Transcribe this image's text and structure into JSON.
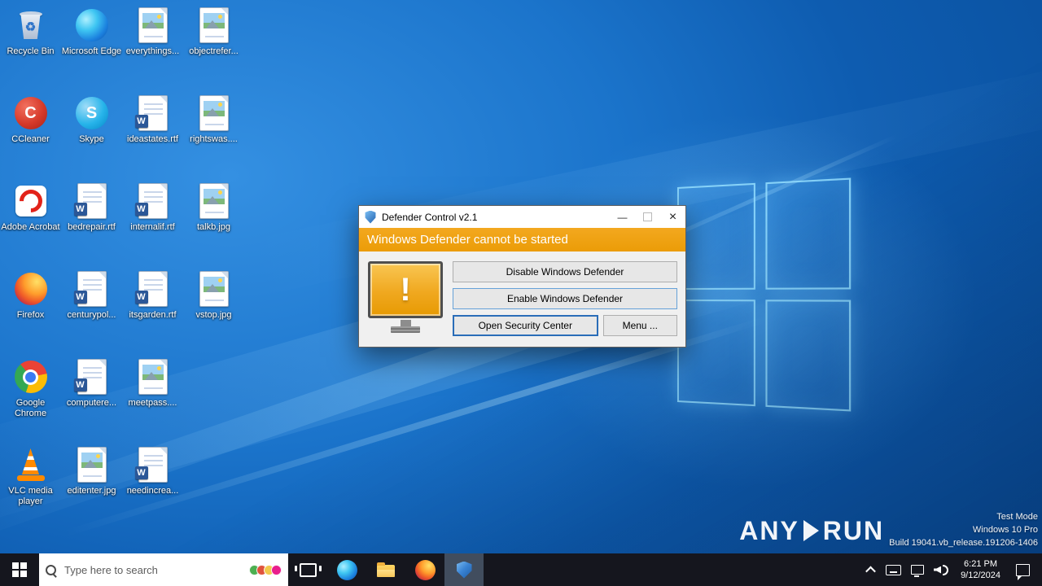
{
  "wallpaper": {
    "base_color": "#0e5cb0",
    "accent_glow": "#7ec8ff"
  },
  "desktop": {
    "icons": [
      {
        "name": "recycle-bin",
        "type": "recycle",
        "label": "Recycle Bin",
        "col": 0,
        "row": 0
      },
      {
        "name": "microsoft-edge",
        "type": "edge",
        "label": "Microsoft Edge",
        "col": 1,
        "row": 0
      },
      {
        "name": "file-everythings",
        "type": "image",
        "label": "everythings...",
        "col": 2,
        "row": 0
      },
      {
        "name": "file-objectrefer",
        "type": "image",
        "label": "objectrefer...",
        "col": 3,
        "row": 0
      },
      {
        "name": "ccleaner",
        "type": "ccleaner",
        "label": "CCleaner",
        "col": 0,
        "row": 1
      },
      {
        "name": "skype",
        "type": "skype",
        "label": "Skype",
        "col": 1,
        "row": 1
      },
      {
        "name": "file-ideastates",
        "type": "word",
        "label": "ideastates.rtf",
        "col": 2,
        "row": 1
      },
      {
        "name": "file-rightswas",
        "type": "image",
        "label": "rightswas....",
        "col": 3,
        "row": 1
      },
      {
        "name": "adobe-acrobat",
        "type": "acrobat",
        "label": "Adobe Acrobat",
        "col": 0,
        "row": 2
      },
      {
        "name": "file-bedrepair",
        "type": "word",
        "label": "bedrepair.rtf",
        "col": 1,
        "row": 2
      },
      {
        "name": "file-internalif",
        "type": "word",
        "label": "internalif.rtf",
        "col": 2,
        "row": 2
      },
      {
        "name": "file-talkb",
        "type": "image",
        "label": "talkb.jpg",
        "col": 3,
        "row": 2
      },
      {
        "name": "firefox",
        "type": "firefox",
        "label": "Firefox",
        "col": 0,
        "row": 3
      },
      {
        "name": "file-centurypol",
        "type": "word",
        "label": "centurypol...",
        "col": 1,
        "row": 3
      },
      {
        "name": "file-itsgarden",
        "type": "word",
        "label": "itsgarden.rtf",
        "col": 2,
        "row": 3
      },
      {
        "name": "file-vstop",
        "type": "image",
        "label": "vstop.jpg",
        "col": 3,
        "row": 3
      },
      {
        "name": "google-chrome",
        "type": "chrome",
        "label": "Google Chrome",
        "col": 0,
        "row": 4
      },
      {
        "name": "file-computere",
        "type": "word",
        "label": "computere...",
        "col": 1,
        "row": 4
      },
      {
        "name": "file-meetpass",
        "type": "image",
        "label": "meetpass....",
        "col": 2,
        "row": 4
      },
      {
        "name": "vlc-media-player",
        "type": "vlc",
        "label": "VLC media player",
        "col": 0,
        "row": 5
      },
      {
        "name": "file-editenter",
        "type": "image",
        "label": "editenter.jpg",
        "col": 1,
        "row": 5
      },
      {
        "name": "file-needincrea",
        "type": "word",
        "label": "needincrea...",
        "col": 2,
        "row": 5
      }
    ]
  },
  "dialog": {
    "title": "Defender Control v2.1",
    "banner": "Windows Defender cannot be started",
    "warning_glyph": "!",
    "controls": {
      "minimize": "—",
      "close": "×"
    },
    "buttons": {
      "disable": "Disable Windows Defender",
      "enable": "Enable Windows Defender",
      "open_security": "Open Security Center",
      "menu": "Menu ..."
    }
  },
  "taskbar": {
    "search": {
      "placeholder": "Type here to search"
    },
    "apps": [
      {
        "name": "task-view",
        "type": "taskview",
        "active": false
      },
      {
        "name": "microsoft-edge",
        "type": "edge",
        "active": false
      },
      {
        "name": "file-explorer",
        "type": "explorer",
        "active": false
      },
      {
        "name": "firefox",
        "type": "firefox",
        "active": false
      },
      {
        "name": "defender-control",
        "type": "defender",
        "active": true
      }
    ],
    "tray": {
      "icons": [
        {
          "name": "chevron-up"
        },
        {
          "name": "touch-keyboard"
        },
        {
          "name": "network"
        },
        {
          "name": "volume"
        }
      ],
      "clock": {
        "time": "6:21 PM",
        "date": "9/12/2024"
      }
    }
  },
  "watermark": {
    "brand_left": "ANY",
    "brand_right": "RUN",
    "lines": [
      "Test Mode",
      "Windows 10 Pro",
      "Build 19041.vb_release.191206-1406"
    ]
  },
  "icon_glyphs": {
    "recycle": "♻",
    "ccleaner": "C",
    "skype": "S",
    "word_badge": "W"
  }
}
